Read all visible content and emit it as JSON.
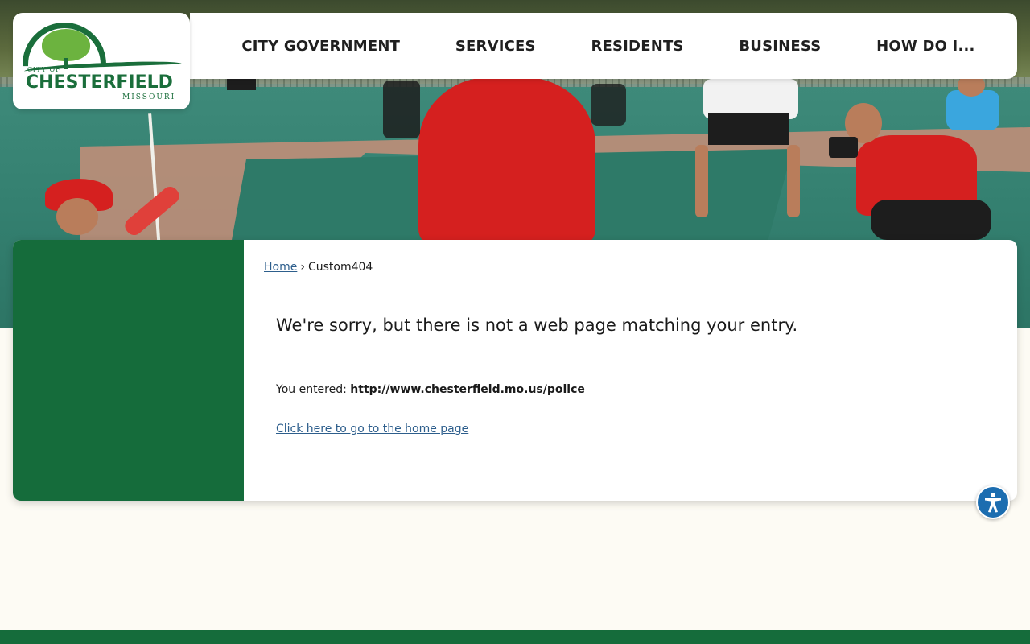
{
  "header": {
    "logo": {
      "city_of": "CITY OF",
      "name": "CHESTERFIELD",
      "state": "MISSOURI"
    },
    "nav": [
      {
        "label": "CITY GOVERNMENT"
      },
      {
        "label": "SERVICES"
      },
      {
        "label": "RESIDENTS"
      },
      {
        "label": "BUSINESS"
      },
      {
        "label": "HOW DO I..."
      }
    ]
  },
  "breadcrumb": {
    "home": "Home",
    "separator": "›",
    "current": "Custom404"
  },
  "content": {
    "message": "We're sorry, but there is not a web page matching your entry.",
    "entered_label": "You entered:",
    "entered_url": "http://www.chesterfield.mo.us/police",
    "home_link": "Click here to go to the home page"
  },
  "accessibility": {
    "icon": "accessibility-icon"
  },
  "colors": {
    "brand_green": "#156c3b",
    "link_blue": "#2d5e8c",
    "page_bg": "#fdfbf4",
    "a11y_blue": "#1c6db0"
  }
}
